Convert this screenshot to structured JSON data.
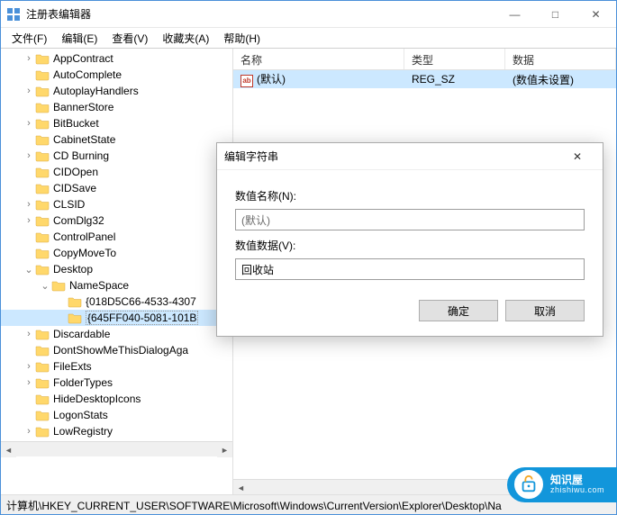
{
  "window": {
    "title": "注册表编辑器",
    "min": "—",
    "max": "□",
    "close": "✕"
  },
  "menu": {
    "file": "文件(F)",
    "edit": "编辑(E)",
    "view": "查看(V)",
    "favorites": "收藏夹(A)",
    "help": "帮助(H)"
  },
  "tree": {
    "items": [
      {
        "indent": 1,
        "toggle": ">",
        "label": "AppContract"
      },
      {
        "indent": 1,
        "toggle": "",
        "label": "AutoComplete"
      },
      {
        "indent": 1,
        "toggle": ">",
        "label": "AutoplayHandlers"
      },
      {
        "indent": 1,
        "toggle": "",
        "label": "BannerStore"
      },
      {
        "indent": 1,
        "toggle": ">",
        "label": "BitBucket"
      },
      {
        "indent": 1,
        "toggle": "",
        "label": "CabinetState"
      },
      {
        "indent": 1,
        "toggle": ">",
        "label": "CD Burning"
      },
      {
        "indent": 1,
        "toggle": "",
        "label": "CIDOpen"
      },
      {
        "indent": 1,
        "toggle": "",
        "label": "CIDSave"
      },
      {
        "indent": 1,
        "toggle": ">",
        "label": "CLSID"
      },
      {
        "indent": 1,
        "toggle": ">",
        "label": "ComDlg32"
      },
      {
        "indent": 1,
        "toggle": "",
        "label": "ControlPanel"
      },
      {
        "indent": 1,
        "toggle": "",
        "label": "CopyMoveTo"
      },
      {
        "indent": 1,
        "toggle": "v",
        "label": "Desktop"
      },
      {
        "indent": 2,
        "toggle": "v",
        "label": "NameSpace"
      },
      {
        "indent": 3,
        "toggle": "",
        "label": "{018D5C66-4533-4307"
      },
      {
        "indent": 3,
        "toggle": "",
        "label": "{645FF040-5081-101B",
        "selected": true
      },
      {
        "indent": 1,
        "toggle": ">",
        "label": "Discardable"
      },
      {
        "indent": 1,
        "toggle": "",
        "label": "DontShowMeThisDialogAga"
      },
      {
        "indent": 1,
        "toggle": ">",
        "label": "FileExts"
      },
      {
        "indent": 1,
        "toggle": ">",
        "label": "FolderTypes"
      },
      {
        "indent": 1,
        "toggle": "",
        "label": "HideDesktopIcons"
      },
      {
        "indent": 1,
        "toggle": "",
        "label": "LogonStats"
      },
      {
        "indent": 1,
        "toggle": ">",
        "label": "LowRegistry"
      }
    ]
  },
  "list": {
    "headers": {
      "name": "名称",
      "type": "类型",
      "data": "数据"
    },
    "rows": [
      {
        "icon": "ab",
        "name": "(默认)",
        "type": "REG_SZ",
        "data": "(数值未设置)",
        "selected": true
      }
    ]
  },
  "statusbar": {
    "path": "计算机\\HKEY_CURRENT_USER\\SOFTWARE\\Microsoft\\Windows\\CurrentVersion\\Explorer\\Desktop\\Na"
  },
  "dialog": {
    "title": "编辑字符串",
    "name_label": "数值名称(N):",
    "name_value": "(默认)",
    "data_label": "数值数据(V):",
    "data_value": "回收站",
    "ok": "确定",
    "cancel": "取消",
    "close": "✕"
  },
  "watermark": {
    "text": "知识屋",
    "url": "zhishiwu.com"
  }
}
